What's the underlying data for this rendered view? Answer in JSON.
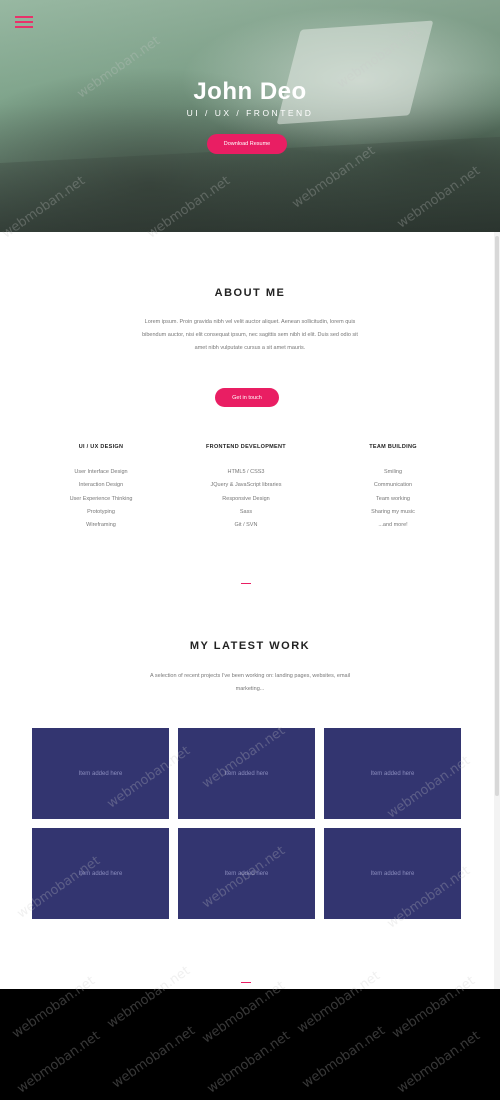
{
  "hero": {
    "name": "John Deo",
    "tagline": "UI / UX / FRONTEND",
    "cta_label": "Download Resume",
    "menu_icon": "hamburger-menu-icon"
  },
  "about": {
    "title": "ABOUT ME",
    "body": "Lorem ipsum. Proin gravida nibh vel velit auctor aliquet. Aenean sollicitudin, lorem quis bibendum auctor, nisi elit consequat ipsum, nec sagittis sem nibh id elit. Duis sed odio sit amet nibh vulputate cursus a sit amet mauris.",
    "cta_label": "Get in touch",
    "skills": [
      {
        "heading": "UI / UX DESIGN",
        "items": [
          "User Interface Design",
          "Interaction Design",
          "User Experience Thinking",
          "Prototyping",
          "Wireframing"
        ]
      },
      {
        "heading": "FRONTEND DEVELOPMENT",
        "items": [
          "HTML5 / CSS3",
          "JQuery & JavaScript libraries",
          "Responsive Design",
          "Sass",
          "Git / SVN"
        ]
      },
      {
        "heading": "TEAM BUILDING",
        "items": [
          "Smiling",
          "Communication",
          "Team working",
          "Sharing my music",
          "...and more!"
        ]
      }
    ]
  },
  "work": {
    "title": "MY LATEST WORK",
    "body": "A selection of recent projects I've been working on: landing pages, websites, email marketing...",
    "items": [
      {
        "label": "Item added here"
      },
      {
        "label": "Item added here"
      },
      {
        "label": "Item added here"
      },
      {
        "label": "Item added here"
      },
      {
        "label": "Item added here"
      },
      {
        "label": "Item added here"
      }
    ]
  },
  "watermark": "webmoban.net",
  "colors": {
    "accent": "#e91e63",
    "work_tile": "#333570",
    "footer": "#000000"
  }
}
